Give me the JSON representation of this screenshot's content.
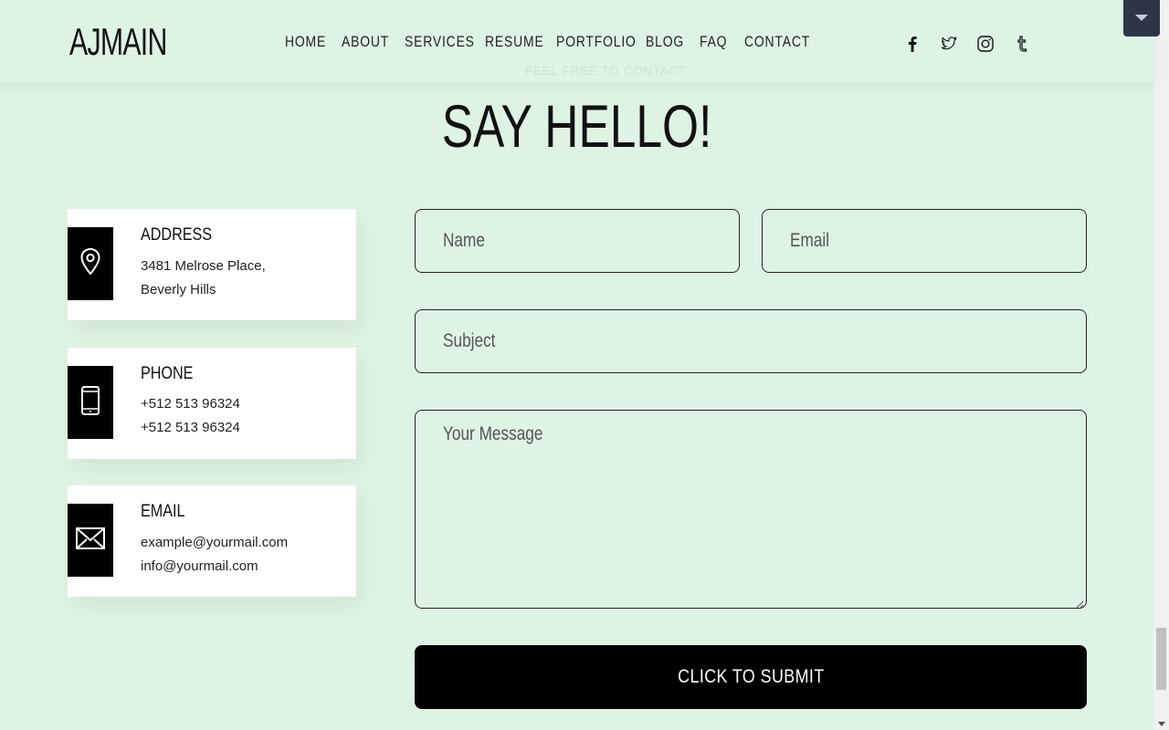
{
  "header": {
    "logo": "AJMAIN",
    "nav": [
      "HOME",
      "ABOUT",
      "SERVICES",
      "RESUME",
      "PORTFOLIO",
      "BLOG",
      "FAQ",
      "CONTACT"
    ],
    "social": [
      "facebook-icon",
      "twitter-icon",
      "instagram-icon",
      "tumblr-icon"
    ]
  },
  "section": {
    "subtitle": "FEEL FREE TO CONTACT",
    "title": "SAY HELLO!"
  },
  "cards": [
    {
      "title": "ADDRESS",
      "lines": [
        "3481 Melrose Place,",
        "Beverly Hills"
      ],
      "icon": "map-pin-icon"
    },
    {
      "title": "PHONE",
      "lines": [
        "+512 513 96324",
        "+512 513 96324"
      ],
      "icon": "mobile-phone-icon"
    },
    {
      "title": "EMAIL",
      "lines": [
        "example@yourmail.com",
        "info@yourmail.com"
      ],
      "icon": "envelope-icon"
    }
  ],
  "form": {
    "name_placeholder": "Name",
    "email_placeholder": "Email",
    "subject_placeholder": "Subject",
    "message_placeholder": "Your Message",
    "submit_label": "CLICK TO SUBMIT"
  },
  "colors": {
    "background": "#dff3e4",
    "accent": "#000000",
    "corner_button": "#2e3547"
  }
}
